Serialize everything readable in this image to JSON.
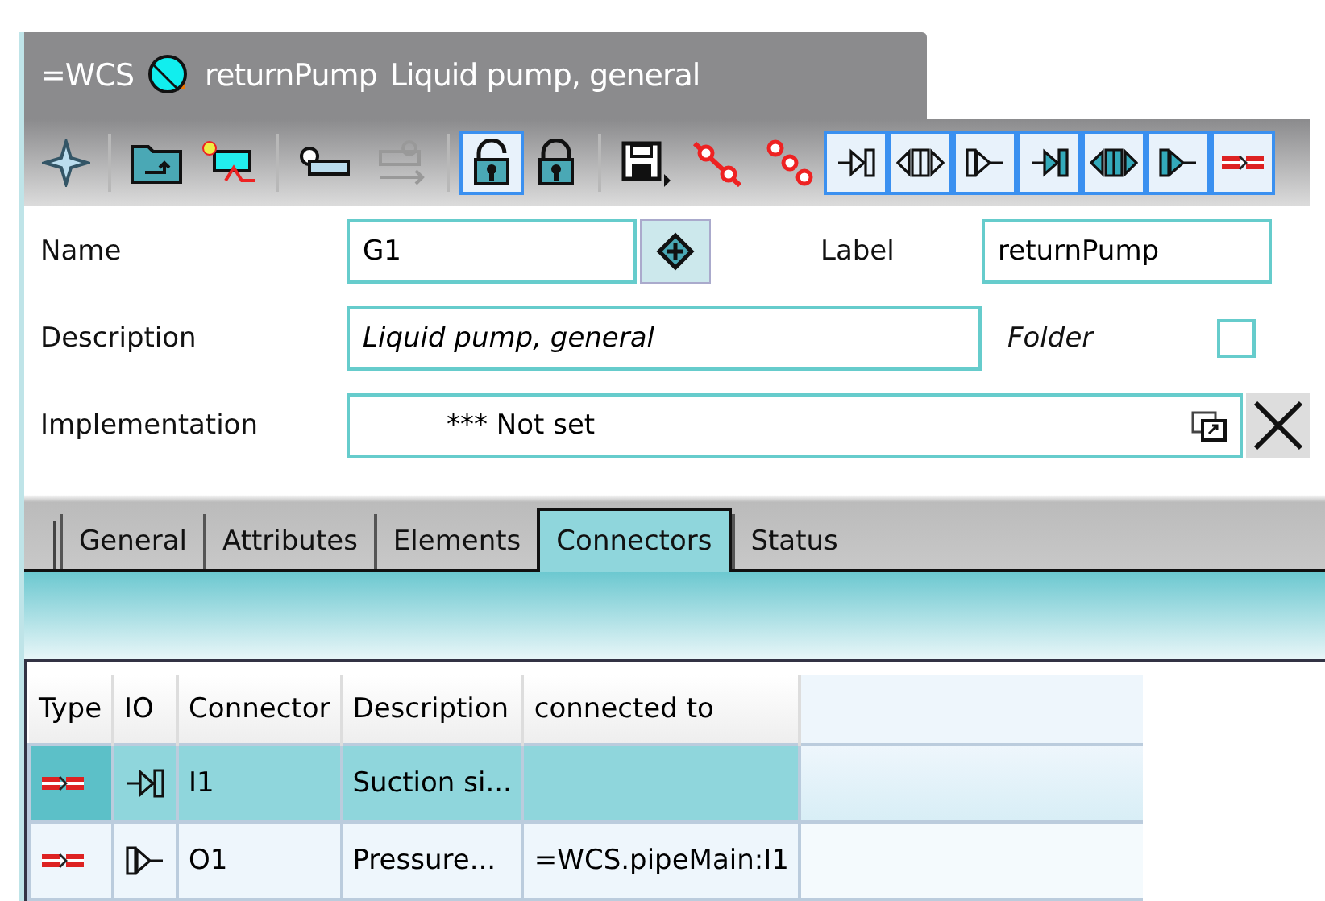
{
  "header": {
    "namespace": "=WCS",
    "name": "returnPump",
    "description": "Liquid pump, general"
  },
  "toolbar": [
    {
      "kind": "target",
      "selected": false
    },
    {
      "kind": "sep"
    },
    {
      "kind": "folder-up",
      "selected": false
    },
    {
      "kind": "new-element",
      "selected": false
    },
    {
      "kind": "sep"
    },
    {
      "kind": "component",
      "selected": false
    },
    {
      "kind": "transfer",
      "selected": false,
      "disabled": true
    },
    {
      "kind": "sep"
    },
    {
      "kind": "lock-open",
      "selected": true
    },
    {
      "kind": "lock",
      "selected": false
    },
    {
      "kind": "sep"
    },
    {
      "kind": "save",
      "selected": false
    },
    {
      "kind": "chain",
      "selected": false
    },
    {
      "kind": "dots",
      "selected": false
    },
    {
      "kind": "io-in",
      "selected": true
    },
    {
      "kind": "io-both",
      "selected": true
    },
    {
      "kind": "io-out",
      "selected": true
    },
    {
      "kind": "io-in-bold",
      "selected": true
    },
    {
      "kind": "io-both-bold",
      "selected": true
    },
    {
      "kind": "io-out-bold",
      "selected": true
    },
    {
      "kind": "connector",
      "selected": true
    }
  ],
  "form": {
    "name_label": "Name",
    "name_value": "G1",
    "label_label": "Label",
    "label_value": "returnPump",
    "description_label": "Description",
    "description_value": "Liquid pump, general",
    "folder_label": "Folder",
    "folder_checked": false,
    "implementation_label": "Implementation",
    "implementation_value": "*** Not set"
  },
  "tabs": [
    {
      "label": "General",
      "selected": false
    },
    {
      "label": "Attributes",
      "selected": false
    },
    {
      "label": "Elements",
      "selected": false
    },
    {
      "label": "Connectors",
      "selected": true
    },
    {
      "label": "Status",
      "selected": false
    }
  ],
  "table": {
    "columns": [
      "Type",
      "IO",
      "Connector",
      "Description",
      "connected to"
    ],
    "rows": [
      {
        "type": {
          "kind": "connector"
        },
        "io": {
          "kind": "in"
        },
        "connector": "I1",
        "description": "Suction si...",
        "selected": true
      },
      {
        "type": {
          "kind": "connector"
        },
        "io": {
          "kind": "out"
        },
        "connector": "O1",
        "description": "Pressure...",
        "connected_to": "=WCS.pipeMain:I1",
        "selected": false
      }
    ]
  }
}
